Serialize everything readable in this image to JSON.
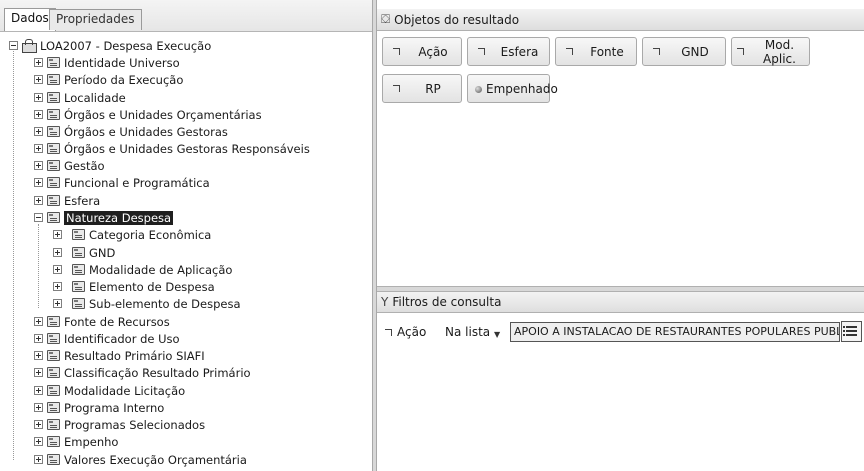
{
  "tabs": {
    "dados": "Dados",
    "propriedades": "Propriedades"
  },
  "tree": {
    "root": "LOA2007 - Despesa Execução",
    "items": [
      "Identidade Universo",
      "Período da Execução",
      "Localidade",
      "Órgãos e Unidades Orçamentárias",
      "Órgãos e Unidades Gestoras",
      "Órgãos e Unidades Gestoras Responsáveis",
      "Gestão",
      "Funcional e Programática",
      "Esfera",
      "Natureza Despesa",
      "Categoria Econômica",
      "GND",
      "Modalidade de Aplicação",
      "Elemento de Despesa",
      "Sub-elemento de Despesa",
      "Fonte de Recursos",
      "Identificador de Uso",
      "Resultado Primário SIAFI",
      "Classificação Resultado Primário",
      "Modalidade Licitação",
      "Programa Interno",
      "Programas Selecionados",
      "Empenho",
      "Valores Execução Orçamentária"
    ],
    "selected": "Natureza Despesa"
  },
  "result_objects": {
    "title": "Objetos do resultado",
    "chips": [
      "Ação",
      "Esfera",
      "Fonte",
      "GND",
      "Mod. Aplic.",
      "RP",
      "Empenhado"
    ]
  },
  "filters": {
    "title": "Filtros de consulta",
    "field": "Ação",
    "operator": "Na lista",
    "value": "APOIO A INSTALACAO DE RESTAURANTES POPULARES PUBLI"
  },
  "icons": {
    "root": "cube-icon",
    "folder": "folder-icon",
    "dimension": "dimension-icon",
    "measure": "measure-icon",
    "filter": "funnel-icon",
    "list": "list-icon"
  }
}
